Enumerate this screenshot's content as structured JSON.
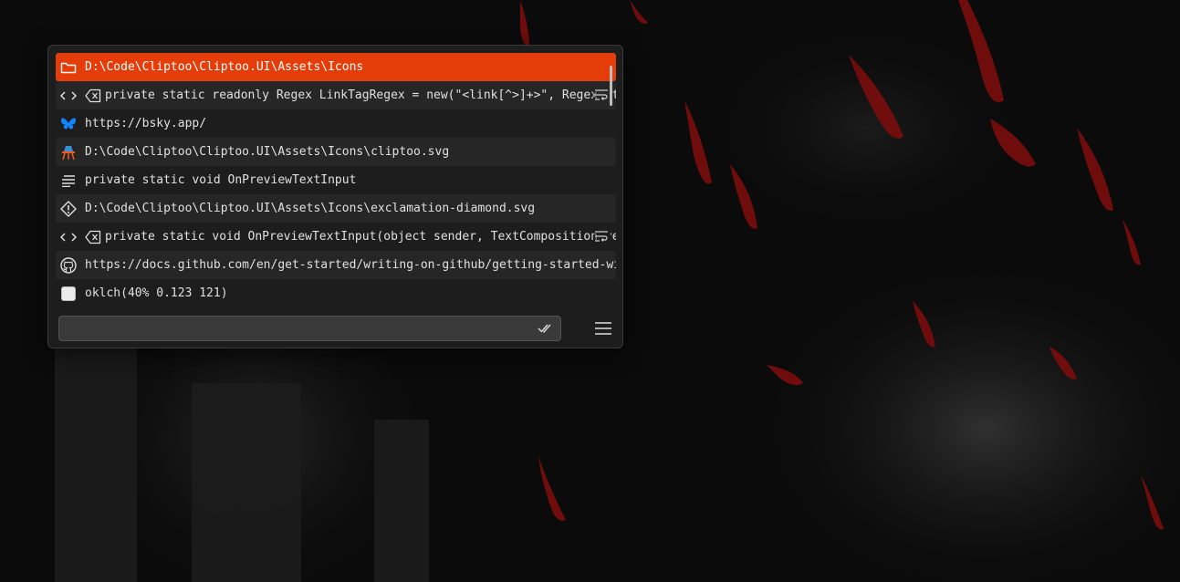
{
  "colors": {
    "accent": "#e53d0a",
    "panel_bg": "#1d1d1d",
    "row_alt_bg": "#262626",
    "bluesky_blue": "#1185fe",
    "cliptoo_orange": "#f05a1c",
    "cliptoo_blue": "#3a8fd8"
  },
  "clipboard": {
    "items": [
      {
        "icon": "folder-icon",
        "text": "D:\\Code\\Cliptoo\\Cliptoo.UI\\Assets\\Icons",
        "selected": true
      },
      {
        "icon": "code-icon",
        "secondary_icon": "clear-format-icon",
        "text": "private static readonly Regex LinkTagRegex = new(\"<link[^>]+>\", RegexOptions.Compiled | RegexOptions.IgnoreCase);",
        "trailing_icon": "wrap-text-icon"
      },
      {
        "icon": "bluesky-butterfly-icon",
        "text": "https://bsky.app/"
      },
      {
        "icon": "cliptoo-logo-icon",
        "text": "D:\\Code\\Cliptoo\\Cliptoo.UI\\Assets\\Icons\\cliptoo.svg"
      },
      {
        "icon": "text-lines-icon",
        "text": "private static void OnPreviewTextInput"
      },
      {
        "icon": "exclamation-diamond-icon",
        "text": "D:\\Code\\Cliptoo\\Cliptoo.UI\\Assets\\Icons\\exclamation-diamond.svg"
      },
      {
        "icon": "code-icon",
        "secondary_icon": "clear-format-icon",
        "text": "private static void OnPreviewTextInput(object sender, TextCompositionEventArgs e)",
        "trailing_icon": "wrap-text-icon"
      },
      {
        "icon": "github-icon",
        "text": "https://docs.github.com/en/get-started/writing-on-github/getting-started-with-writing-and-formatting-on-github"
      },
      {
        "icon": "color-swatch-icon",
        "text": "oklch(40% 0.123 121)",
        "swatch_color": "#ececec"
      }
    ]
  },
  "search": {
    "value": "",
    "placeholder": "",
    "right_icon": "double-check-icon"
  },
  "menu": {
    "icon": "hamburger-menu-icon"
  }
}
